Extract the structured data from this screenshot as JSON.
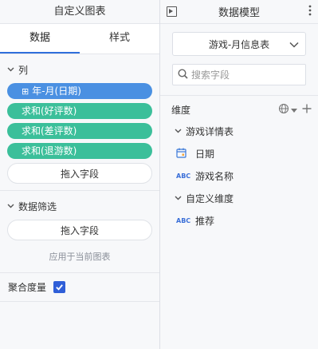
{
  "left": {
    "title": "自定义图表",
    "tabs": [
      {
        "label": "数据"
      },
      {
        "label": "样式"
      }
    ],
    "columns": {
      "label": "列",
      "fields": [
        {
          "label": "年-月(日期)",
          "kind": "date",
          "color": "#4a90e2"
        },
        {
          "label": "求和(好评数)",
          "kind": "measure",
          "color": "#3bbf9a"
        },
        {
          "label": "求和(差评数)",
          "kind": "measure",
          "color": "#3bbf9a"
        },
        {
          "label": "求和(退游数)",
          "kind": "measure",
          "color": "#3bbf9a"
        }
      ],
      "drop_label": "拖入字段"
    },
    "filter": {
      "label": "数据筛选",
      "drop_label": "拖入字段",
      "apply_label": "应用于当前图表"
    },
    "aggregate": {
      "label": "聚合度量",
      "checked": true
    }
  },
  "right": {
    "title": "数据模型",
    "table_select": "游戏-月信息表",
    "search_placeholder": "搜索字段",
    "dimension_label": "维度",
    "groups": [
      {
        "label": "游戏详情表",
        "items": [
          {
            "label": "日期",
            "type_icon": "calendar-icon"
          },
          {
            "label": "游戏名称",
            "type_icon": "abc-icon"
          }
        ]
      },
      {
        "label": "自定义维度",
        "items": [
          {
            "label": "推荐",
            "type_icon": "abc-icon"
          }
        ]
      }
    ],
    "type_badge": "ABC"
  }
}
